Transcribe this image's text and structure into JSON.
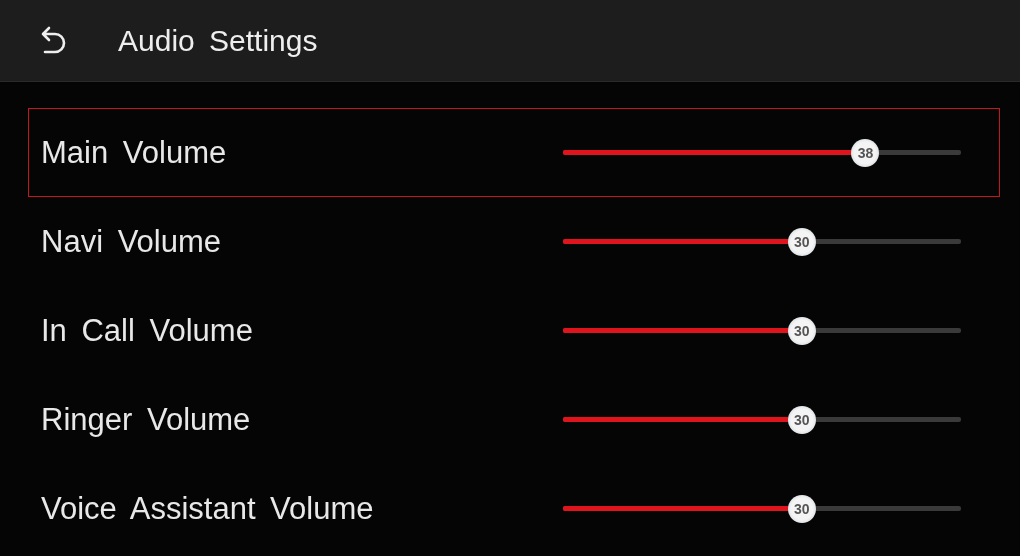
{
  "header": {
    "title": "Audio Settings"
  },
  "settings": [
    {
      "label": "Main Volume",
      "selected": true,
      "level": 0.76,
      "value": "38"
    },
    {
      "label": "Navi Volume",
      "selected": false,
      "level": 0.6,
      "value": "30"
    },
    {
      "label": "In Call Volume",
      "selected": false,
      "level": 0.6,
      "value": "30"
    },
    {
      "label": "Ringer Volume",
      "selected": false,
      "level": 0.6,
      "value": "30"
    },
    {
      "label": "Voice Assistant Volume",
      "selected": false,
      "level": 0.6,
      "value": "30"
    }
  ]
}
